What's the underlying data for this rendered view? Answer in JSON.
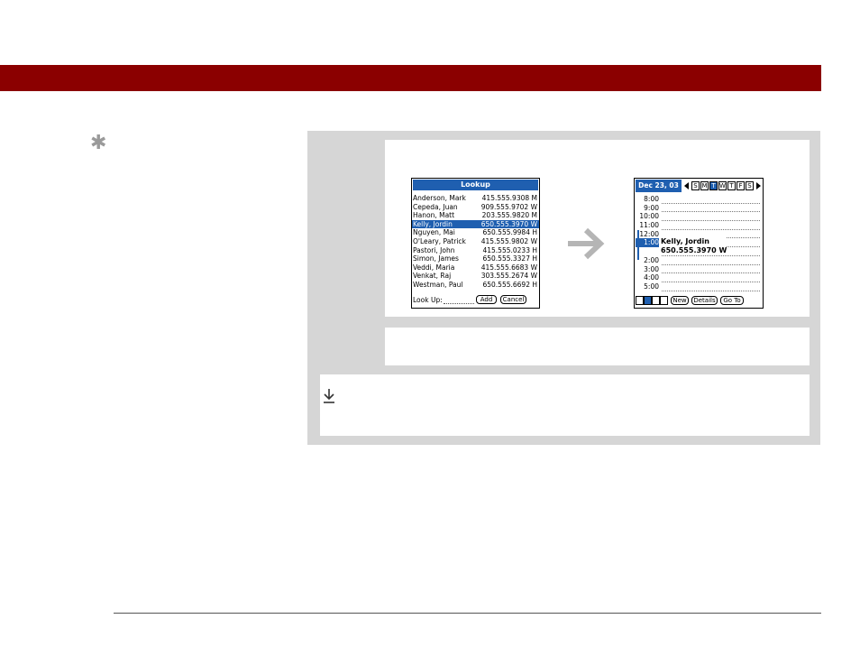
{
  "tip_icon": "asterisk-icon",
  "download_icon": "download-arrow-icon",
  "arrow_icon": "right-arrow-icon",
  "colors": {
    "band": "#8b0000",
    "panel": "#d6d6d6",
    "highlight": "#1f5fb0"
  },
  "lookup": {
    "title": "Lookup",
    "entries": [
      {
        "name": "Anderson, Mark",
        "phone": "415.555.9308 M"
      },
      {
        "name": "Cepeda, Juan",
        "phone": "909.555.9702 W"
      },
      {
        "name": "Hanon, Matt",
        "phone": "203.555.9820 M"
      },
      {
        "name": "Kelly, Jordin",
        "phone": "650.555.3970 W"
      },
      {
        "name": "Nguyen, Mai",
        "phone": "650.555.9984 H"
      },
      {
        "name": "O'Leary, Patrick",
        "phone": "415.555.9802 W"
      },
      {
        "name": "Pastori, John",
        "phone": "415.555.0233 H"
      },
      {
        "name": "Simon, James",
        "phone": "650.555.3327 H"
      },
      {
        "name": "Veddi, Maria",
        "phone": "415.555.6683 W"
      },
      {
        "name": "Venkat, Raj",
        "phone": "303.555.2674 W"
      },
      {
        "name": "Westman, Paul",
        "phone": "650.555.6692 H"
      }
    ],
    "selected_index": 3,
    "look_up_label": "Look Up:",
    "add_label": "Add",
    "cancel_label": "Cancel"
  },
  "datebook": {
    "date_label": "Dec 23, 03",
    "days": [
      "S",
      "M",
      "T",
      "W",
      "T",
      "F",
      "S"
    ],
    "selected_day_index": 2,
    "times": [
      "8:00",
      "9:00",
      "10:00",
      "11:00",
      "12:00",
      "1:00",
      "",
      "2:00",
      "3:00",
      "4:00",
      "5:00"
    ],
    "selected_time_index": 5,
    "event_lines": [
      "Kelly, Jordin",
      "650.555.3970 W"
    ],
    "new_label": "New",
    "details_label": "Details",
    "goto_label": "Go To"
  }
}
